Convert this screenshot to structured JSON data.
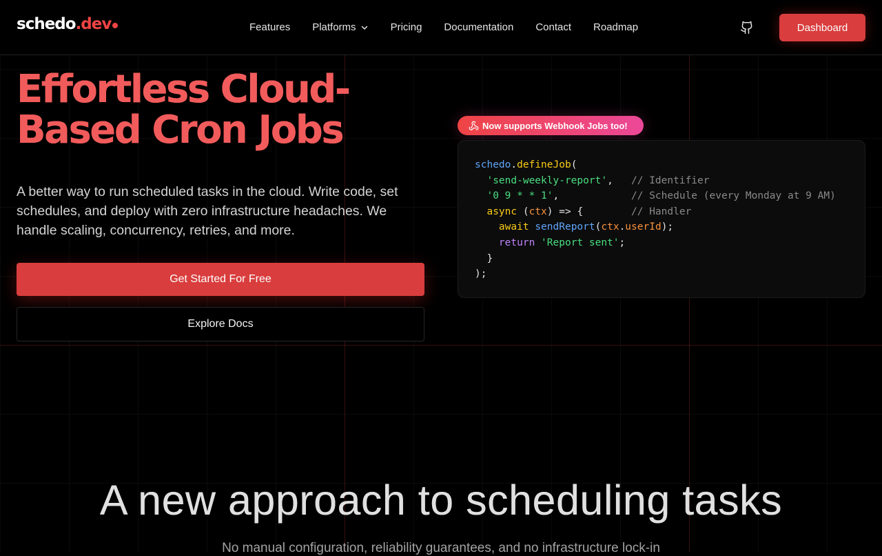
{
  "header": {
    "logo_text": "schedo",
    "logo_suffix": ".dev",
    "nav": [
      "Features",
      "Platforms",
      "Pricing",
      "Documentation",
      "Contact",
      "Roadmap"
    ],
    "dashboard_label": "Dashboard"
  },
  "hero": {
    "title_line1": "Effortless Cloud-",
    "title_line2": "Based Cron Jobs",
    "subtitle": "A better way to run scheduled tasks in the cloud. Write code, set schedules, and deploy with zero infrastructure headaches. We handle scaling, concurrency, retries, and more.",
    "cta_primary": "Get Started For Free",
    "cta_secondary": "Explore Docs",
    "badge": "Now supports Webhook Jobs too!"
  },
  "code": {
    "obj": "schedo",
    "method": "defineJob",
    "id": "'send-weekly-report'",
    "id_comment": "// Identifier",
    "schedule": "'0 9 * * 1'",
    "schedule_comment": "// Schedule (every Monday at 9 AM)",
    "async_kw": "async",
    "param": "ctx",
    "handler_comment": "// Handler",
    "await_kw": "await",
    "call": "sendReport",
    "prop": "userId",
    "return_kw": "return",
    "return_val": "'Report sent'"
  },
  "section": {
    "title": "A new approach to scheduling tasks",
    "subtitle": "No manual configuration, reliability guarantees, and no infrastructure lock-in"
  },
  "colors": {
    "accent": "#d93d3d",
    "badge_gradient_start": "#ef4444",
    "badge_gradient_end": "#ec4899"
  }
}
